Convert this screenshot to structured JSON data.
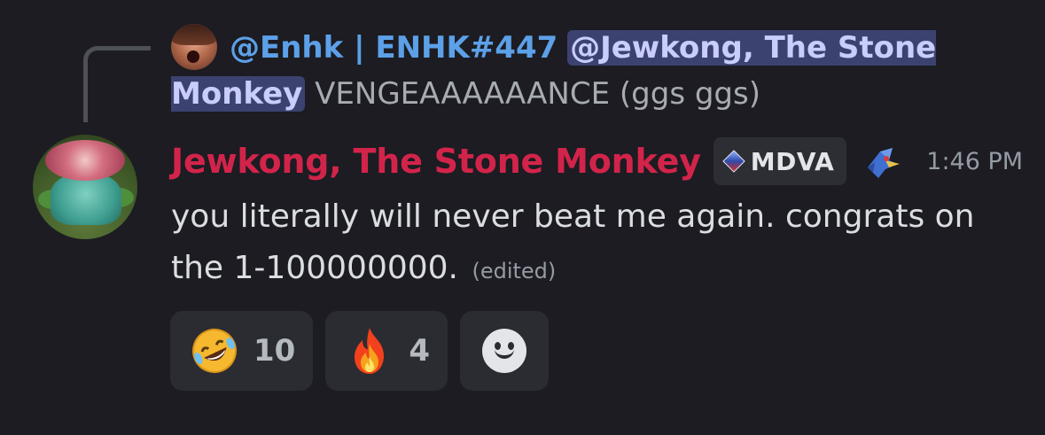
{
  "reply": {
    "author": "@Enhk | ENHK#447",
    "mention": "@Jewkong, The Stone Monkey",
    "text": "VENGEAAAAAANCE (ggs ggs)"
  },
  "message": {
    "author": "Jewkong, The Stone Monkey",
    "author_color": "#d2244a",
    "tag": "MDVA",
    "role_icon": "falco-icon",
    "timestamp": "1:46 PM",
    "text": "you literally will never beat me again. congrats on the 1-100000000.",
    "edited": "(edited)"
  },
  "reactions": [
    {
      "emoji": "rolling-on-floor-laughing-emoji",
      "count": "10"
    },
    {
      "emoji": "fire-emoji",
      "count": "4"
    }
  ],
  "add_reaction_icon": "smiley-add-reaction-icon",
  "colors": {
    "background": "#1c1c22",
    "mention_bg": "#3c4270",
    "reply_author": "#5ca0e8",
    "reaction_bg": "#2b2c32"
  }
}
